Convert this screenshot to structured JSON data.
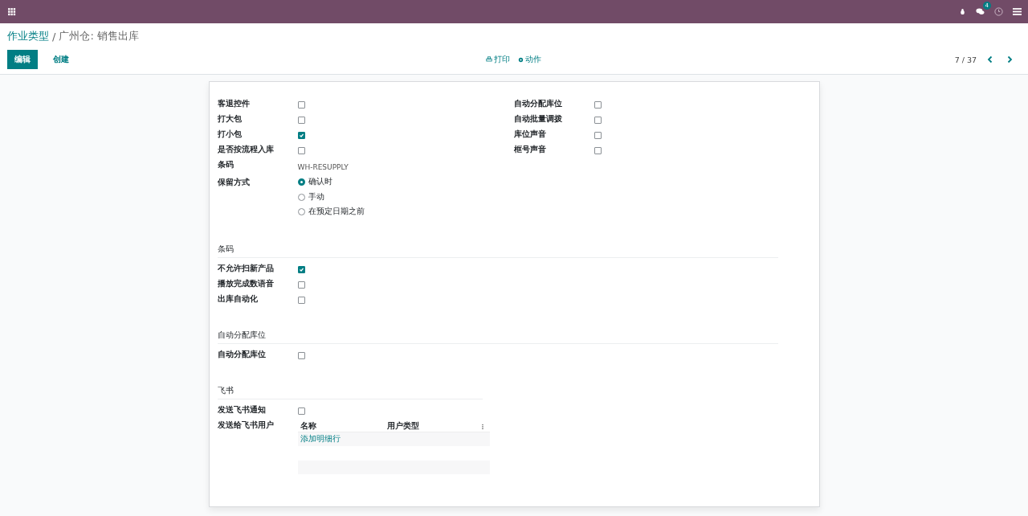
{
  "top_bar": {
    "message_count": "4"
  },
  "breadcrumb": {
    "parent": "作业类型",
    "separator": "/",
    "current": "广州仓: 销售出库"
  },
  "buttons": [
    {
      "label": "编辑",
      "kind": "primary"
    },
    {
      "label": "创建",
      "kind": "link"
    }
  ],
  "actions": [
    {
      "label": "打印",
      "kind": "print"
    },
    {
      "label": "动作",
      "kind": "gear"
    }
  ],
  "pager": "7 / 37",
  "main": {
    "left": [
      {
        "label": "客退控件",
        "kind": "checkbox",
        "checked": false
      },
      {
        "label": "打大包",
        "kind": "checkbox",
        "checked": false
      },
      {
        "label": "打小包",
        "kind": "checkbox",
        "checked": true
      },
      {
        "label": "是否按流程入库",
        "kind": "checkbox",
        "checked": false
      },
      {
        "label": "条码",
        "kind": "text",
        "value": "WH-RESUPPLY"
      },
      {
        "label": "保留方式",
        "kind": "radio",
        "options": [
          {
            "label": "确认时",
            "selected": true
          },
          {
            "label": "手动",
            "selected": false
          },
          {
            "label": "在预定日期之前",
            "selected": false
          }
        ]
      }
    ],
    "right": [
      {
        "label": "自动分配库位",
        "kind": "checkbox",
        "checked": false
      },
      {
        "label": "自动批量调拨",
        "kind": "checkbox",
        "checked": false
      },
      {
        "label": "库位声音",
        "kind": "checkbox",
        "checked": false
      },
      {
        "label": "框号声音",
        "kind": "checkbox",
        "checked": false
      }
    ]
  },
  "sections": [
    {
      "title": "条码",
      "fields": [
        {
          "label": "不允许扫新产品",
          "kind": "checkbox",
          "checked": true
        },
        {
          "label": "播放完成数语音",
          "kind": "checkbox",
          "checked": false
        },
        {
          "label": "出库自动化",
          "kind": "checkbox",
          "checked": false
        }
      ]
    },
    {
      "title": "自动分配库位",
      "fields": [
        {
          "label": "自动分配库位",
          "kind": "checkbox",
          "checked": false
        }
      ]
    },
    {
      "title": "飞书",
      "fields": [
        {
          "label": "发送飞书通知",
          "kind": "checkbox",
          "checked": false
        },
        {
          "label": "发送给飞书用户",
          "kind": "table",
          "columns": [
            "名称",
            "用户类型"
          ],
          "add_line": "添加明细行"
        }
      ]
    }
  ]
}
